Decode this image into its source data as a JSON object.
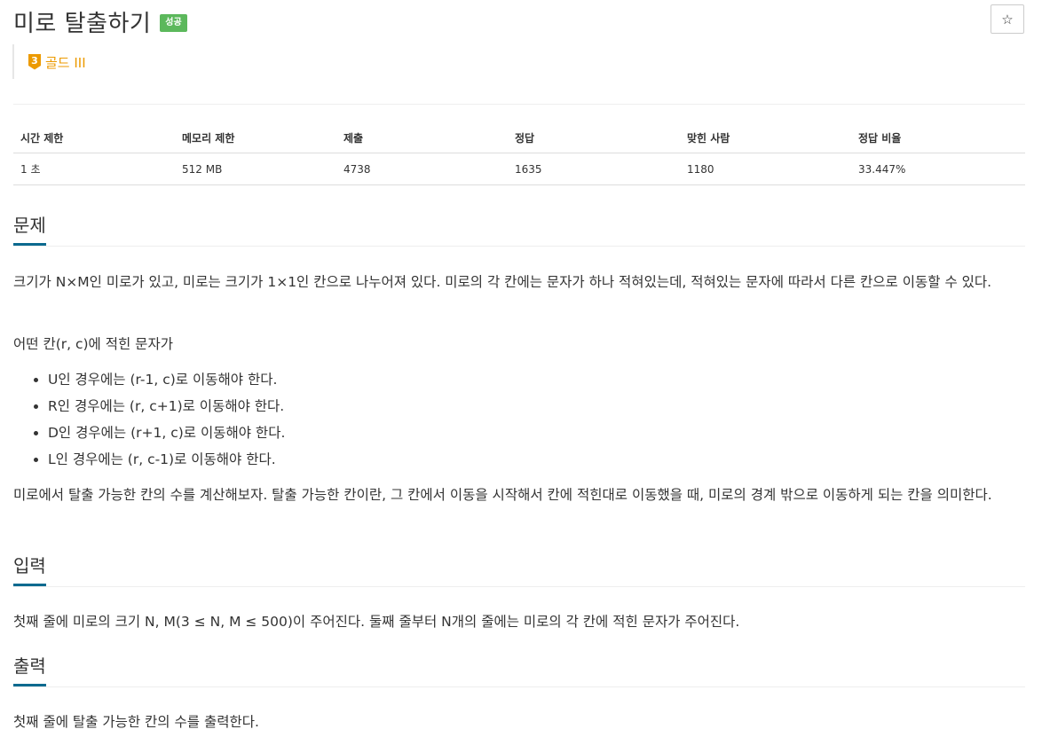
{
  "header": {
    "title": "미로 탈출하기",
    "result_badge": "성공",
    "star_glyph": "☆",
    "tier_number": "3",
    "tier_label": "골드 III",
    "tier_color": "#ec9a00"
  },
  "info_table": {
    "headers": [
      "시간 제한",
      "메모리 제한",
      "제출",
      "정답",
      "맞힌 사람",
      "정답 비율"
    ],
    "row": [
      "1 초",
      "512 MB",
      "4738",
      "1635",
      "1180",
      "33.447%"
    ]
  },
  "sections": {
    "problem": {
      "heading": "문제",
      "paragraph1": "크기가 N×M인 미로가 있고, 미로는 크기가 1×1인 칸으로 나누어져 있다. 미로의 각 칸에는 문자가 하나 적혀있는데, 적혀있는 문자에 따라서 다른 칸으로 이동할 수 있다.",
      "paragraph2": "어떤 칸(r, c)에 적힌 문자가",
      "conditions": [
        "U인 경우에는 (r-1, c)로 이동해야 한다.",
        "R인 경우에는 (r, c+1)로 이동해야 한다.",
        "D인 경우에는 (r+1, c)로 이동해야 한다.",
        "L인 경우에는 (r, c-1)로 이동해야 한다."
      ],
      "paragraph3": "미로에서 탈출 가능한 칸의 수를 계산해보자. 탈출 가능한 칸이란, 그 칸에서 이동을 시작해서 칸에 적힌대로 이동했을 때, 미로의 경계 밖으로 이동하게 되는 칸을 의미한다."
    },
    "input": {
      "heading": "입력",
      "paragraph": "첫째 줄에 미로의 크기 N, M(3 ≤ N, M ≤ 500)이 주어진다. 둘째 줄부터 N개의 줄에는 미로의 각 칸에 적힌 문자가 주어진다."
    },
    "output": {
      "heading": "출력",
      "paragraph": "첫째 줄에 탈출 가능한 칸의 수를 출력한다."
    }
  },
  "colors": {
    "accent_underline": "#0c6a8f",
    "success_badge": "#5cb85c"
  }
}
